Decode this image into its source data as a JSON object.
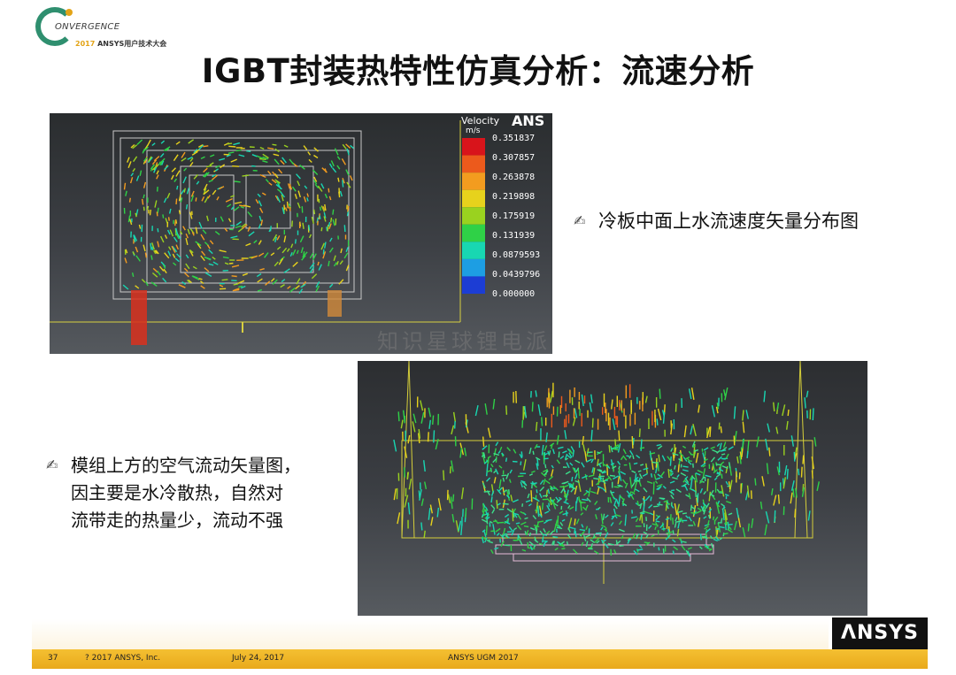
{
  "logo": {
    "name": "ONVERGENCE",
    "year": "2017",
    "subtitle": "ANSYS用户技术大会"
  },
  "title": "IGBT封装热特性仿真分析：流速分析",
  "legend": {
    "heading": "Velocity",
    "unit": "m/s",
    "brand": "ANS",
    "values": [
      "0.351837",
      "0.307857",
      "0.263878",
      "0.219898",
      "0.175919",
      "0.131939",
      "0.0879593",
      "0.0439796",
      "0.000000"
    ],
    "colors": [
      "#d8141b",
      "#ec5a1c",
      "#f39c1f",
      "#e7d21c",
      "#9ad21f",
      "#2fd147",
      "#18d7b2",
      "#1d9ee3",
      "#1c3dd4"
    ]
  },
  "bullet1": "冷板中面上水流速度矢量分布图",
  "bullet2": {
    "line1": "模组上方的空气流动矢量图，",
    "line2": "因主要是水冷散热，自然对",
    "line3": "流带走的热量少，流动不强"
  },
  "watermark": "知识星球锂电派",
  "brand": "ΛNSYS",
  "footer": {
    "page": "37",
    "copyright": "? 2017 ANSYS, Inc.",
    "date": "July 24, 2017",
    "event": "ANSYS UGM 2017"
  }
}
